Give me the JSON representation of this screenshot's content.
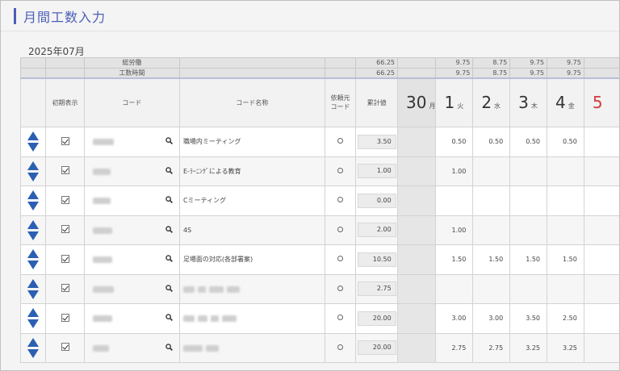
{
  "title": "月間工数入力",
  "month": "2025年07月",
  "summary": {
    "row1_label": "総労働",
    "row1_total": "66.25",
    "row2_label": "工数時間",
    "row2_total": "66.25",
    "row1_days": [
      "",
      "9.75",
      "8.75",
      "9.75",
      "9.75"
    ],
    "row2_days": [
      "",
      "9.75",
      "8.75",
      "9.75",
      "9.75"
    ]
  },
  "headers": {
    "initial_display": "初期表示",
    "code": "コード",
    "code_name": "コード名称",
    "requester_line1": "依頼元",
    "requester_line2": "コード",
    "cumulative": "累計値"
  },
  "days": [
    {
      "num": "30",
      "wd": "月"
    },
    {
      "num": "1",
      "wd": "火"
    },
    {
      "num": "2",
      "wd": "水"
    },
    {
      "num": "3",
      "wd": "木"
    },
    {
      "num": "4",
      "wd": "金"
    },
    {
      "num": "5",
      "wd": ""
    }
  ],
  "rows": [
    {
      "name": "職場内ミーティング",
      "total": "3.50",
      "values": [
        "",
        "0.50",
        "0.50",
        "0.50",
        "0.50"
      ]
    },
    {
      "name": "E-ﾗｰﾆﾝｸﾞによる教育",
      "total": "1.00",
      "values": [
        "",
        "1.00",
        "",
        "",
        ""
      ]
    },
    {
      "name": "Cミーティング",
      "total": "0.00",
      "values": [
        "",
        "",
        "",
        "",
        ""
      ]
    },
    {
      "name": "4S",
      "total": "2.00",
      "values": [
        "",
        "1.00",
        "",
        "",
        ""
      ]
    },
    {
      "name": "足場面の対応(各部署案)",
      "total": "10.50",
      "values": [
        "",
        "1.50",
        "1.50",
        "1.50",
        "1.50"
      ]
    },
    {
      "name": "",
      "total": "2.75",
      "values": [
        "",
        "",
        "",
        "",
        ""
      ]
    },
    {
      "name": "",
      "total": "20.00",
      "values": [
        "",
        "3.00",
        "3.00",
        "3.50",
        "2.50"
      ]
    },
    {
      "name": "",
      "total": "20.00",
      "values": [
        "",
        "2.75",
        "2.75",
        "3.25",
        "3.25"
      ]
    }
  ]
}
